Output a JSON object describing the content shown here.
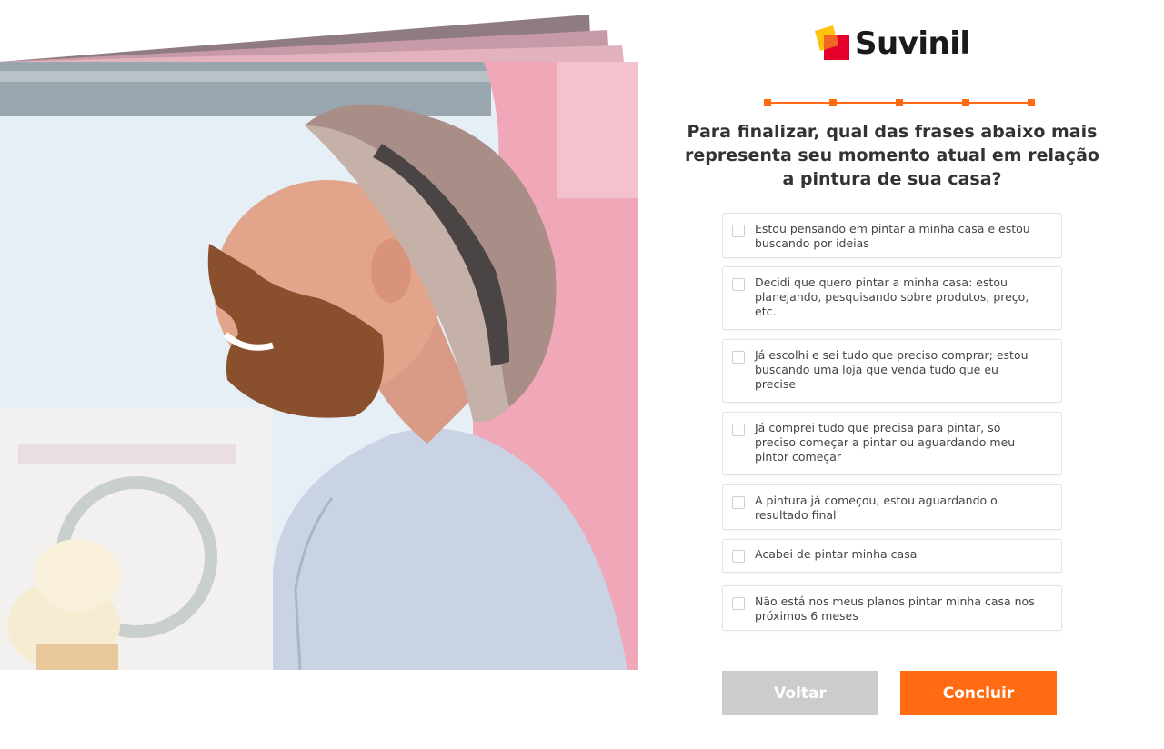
{
  "brand": {
    "name": "Suvinil",
    "colors": {
      "accent": "#ff6a13",
      "logo_yellow": "#ffc20e",
      "logo_red": "#e4002b"
    }
  },
  "progress": {
    "total_steps": 5,
    "current_step": 5
  },
  "question": "Para finalizar, qual das frases abaixo mais representa seu momento atual em relação a pintura de sua casa?",
  "options": [
    {
      "label": "Estou pensando em pintar a minha casa e estou buscando por ideias",
      "checked": false
    },
    {
      "label": "Decidi que quero pintar a minha casa: estou planejando, pesquisando sobre produtos, preço, etc.",
      "checked": false
    },
    {
      "label": "Já escolhi e sei tudo que preciso comprar; estou buscando uma loja que venda tudo que eu precise",
      "checked": false
    },
    {
      "label": "Já comprei tudo que precisa para pintar, só preciso começar a pintar ou aguardando meu pintor começar",
      "checked": false
    },
    {
      "label": "A pintura já começou, estou aguardando o resultado final",
      "checked": false
    },
    {
      "label": "Acabei de pintar minha casa",
      "checked": false
    },
    {
      "label": "Não está nos meus planos pintar minha casa nos próximos 6 meses",
      "checked": false
    }
  ],
  "buttons": {
    "back_label": "Voltar",
    "finish_label": "Concluir"
  }
}
